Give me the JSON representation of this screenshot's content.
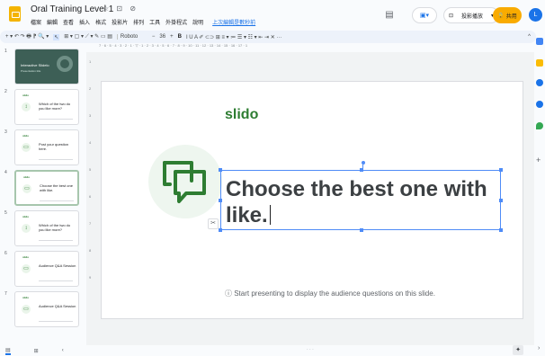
{
  "app": {
    "doc_title": "Oral Training Level 1",
    "title_icons": "☆ ⊡ ⊘",
    "menu": [
      "檔案",
      "編輯",
      "查看",
      "插入",
      "格式",
      "投影片",
      "排列",
      "工具",
      "外掛程式",
      "說明"
    ],
    "last_edit": "上次編輯是數秒前",
    "present_label": "投影播放",
    "share_label": "共用",
    "avatar_letter": "L",
    "comments_icon": "comment-icon",
    "meet_icon": "video-call-icon"
  },
  "toolbar": {
    "left": "+ ▾ ↶ ↷ 🖶 ⁋ 🔍 ▾",
    "select": "↖",
    "tools": "⊞ ▾ ▢ ▾ ⟋ ▾ ✎ ▭ ▤",
    "font": "Roboto",
    "size_minus": "−",
    "size": "36",
    "size_plus": "+",
    "bold": "B",
    "format": "I U A ✐ ⊂⊃ ⊞ ≡ ▾ ≔ ☰ ▾ ☷ ▾ ⇤ ⇥ ✕ ···",
    "collapse": "^"
  },
  "ruler": "7 · 6 · 5 · 4 · 3 · 2 · 1 · ▽ · 1 · 2 · 3 · 4 · 5 · 6 · 7 · 8 · 9 · 10 · 11 · 12 · 13 · 14 · 15 · 16 · 17 · 1",
  "ruler_v": [
    "1",
    "2",
    "3",
    "4",
    "5",
    "6",
    "7",
    "8",
    "9"
  ],
  "slides": [
    {
      "num": "1",
      "kind": "title",
      "title": "Interactive Slidelo",
      "sub": "Presentation title"
    },
    {
      "num": "2",
      "kind": "rating",
      "brand": "slido",
      "question": "Which of the two do you like more?"
    },
    {
      "num": "3",
      "kind": "chat",
      "brand": "slido",
      "question": "Post your question here."
    },
    {
      "num": "4",
      "kind": "chat",
      "brand": "slido",
      "question": "Choose the best one with like."
    },
    {
      "num": "5",
      "kind": "rating",
      "brand": "slido",
      "question": "Which of the two do you like more?"
    },
    {
      "num": "6",
      "kind": "chat",
      "brand": "slido",
      "question": "Audience Q&A Session"
    },
    {
      "num": "7",
      "kind": "chat",
      "brand": "slido",
      "question": "Audience Q&A Session"
    }
  ],
  "active_slide_index": 3,
  "filmstrip_bottom": {
    "list": "▤",
    "grid": "⊞",
    "collapse": "‹"
  },
  "slide": {
    "brand": "slido",
    "question": "Choose the best one with like.",
    "hint": "ⓘ Start presenting to display the audience questions on this slide.",
    "accent_color": "#2e7d32"
  },
  "bottom": {
    "dots": "· · ·",
    "explore": "✦",
    "chevron": "›"
  }
}
